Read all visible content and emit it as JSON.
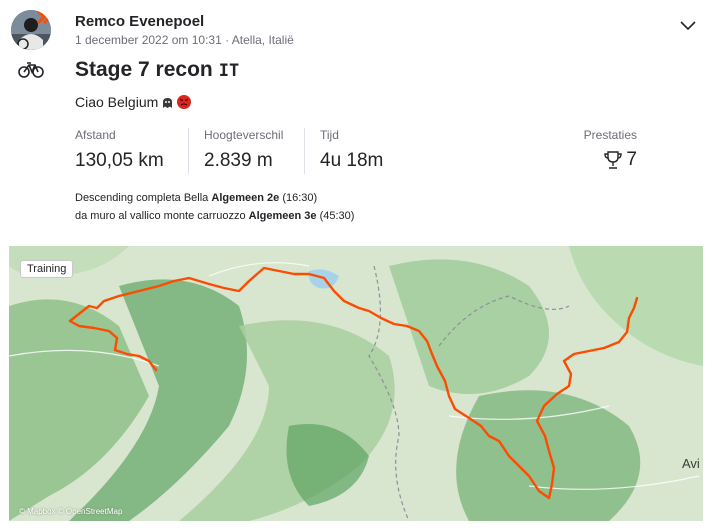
{
  "athlete": {
    "name": "Remco Evenepoel"
  },
  "activity": {
    "date_location": "1 december 2022 om 10:31 · Atella, Italië",
    "title": "Stage 7 recon",
    "title_badge": "IT",
    "description": "Ciao Belgium",
    "sport_icon": "bike-icon"
  },
  "stats": [
    {
      "label": "Afstand",
      "value": "130,05 km"
    },
    {
      "label": "Hoogteverschil",
      "value": "2.839 m"
    },
    {
      "label": "Tijd",
      "value": "4u 18m"
    }
  ],
  "prestaties": {
    "label": "Prestaties",
    "value": "7",
    "icon": "trophy-icon"
  },
  "segments": [
    {
      "name": "Descending completa Bella",
      "rank": "Algemeen 2e",
      "time": "(16:30)"
    },
    {
      "name": "da muro al vallico monte carruozzo",
      "rank": "Algemeen 3e",
      "time": "(45:30)"
    }
  ],
  "map": {
    "tag": "Training",
    "city": "Avi",
    "attribution": "© Mapbox © OpenStreetMap",
    "route_color": "#fc4c02"
  }
}
